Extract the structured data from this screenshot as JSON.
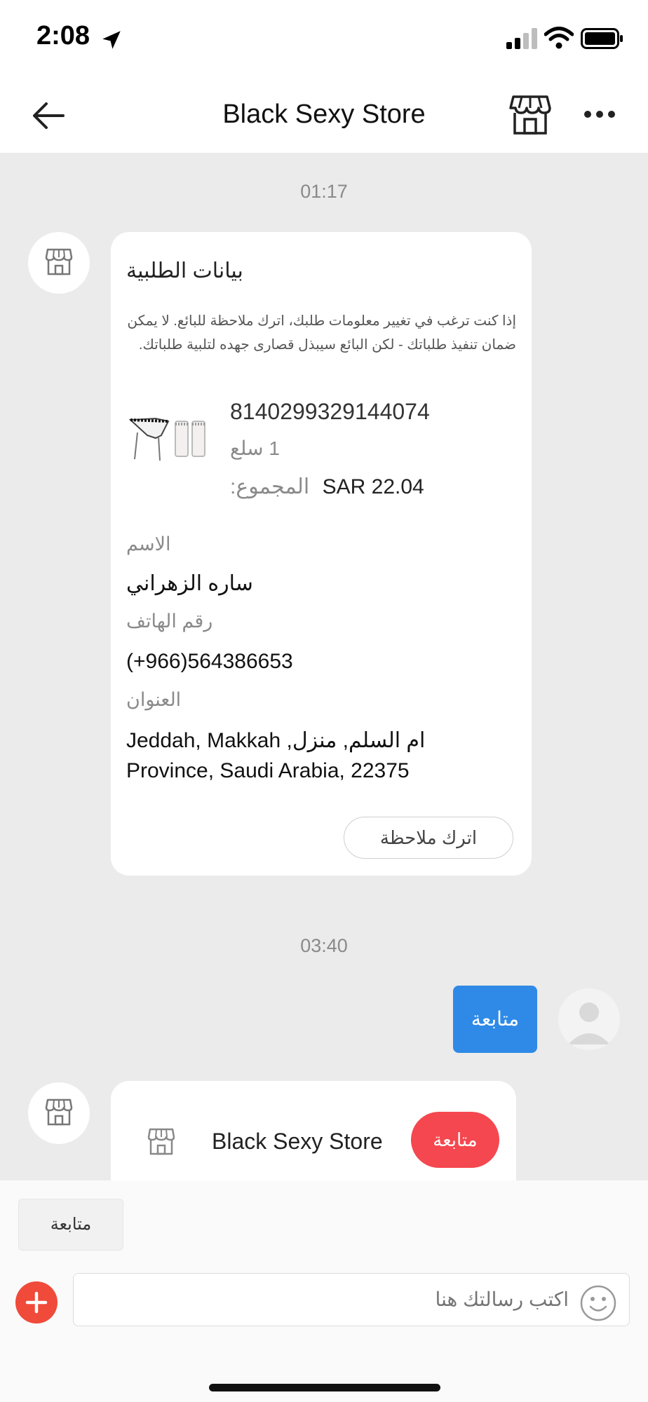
{
  "status_bar": {
    "time": "2:08"
  },
  "header": {
    "title": "Black Sexy Store"
  },
  "chat": {
    "timestamp_1": "01:17",
    "order_card": {
      "title": "بيانات الطلبية",
      "notice": "إذا كنت ترغب في تغيير معلومات طلبك، اترك ملاحظة للبائع. لا يمكن ضمان تنفيذ طلباتك - لكن البائع سيبذل قصارى جهده لتلبية طلباتك.",
      "order_number": "8140299329144074",
      "quantity": "1 سلع",
      "total_label": "المجموع:",
      "total_value": "SAR 22.04",
      "name_label": "الاسم",
      "name_value": "ساره الزهراني",
      "phone_label": "رقم الهاتف",
      "phone_value": "(+966)564386653",
      "address_label": "العنوان",
      "address_line1": "Jeddah, Makkah ,ام السلم, منزل",
      "address_line2": "Province, Saudi Arabia, 22375",
      "leave_note_button": "اترك ملاحظة"
    },
    "timestamp_2": "03:40",
    "user_message": "متابعة",
    "store_card": {
      "store_name": "Black Sexy Store",
      "follow_button": "متابعة"
    }
  },
  "quick_reply": {
    "label": "متابعة"
  },
  "composer": {
    "placeholder": "اكتب رسالتك هنا"
  },
  "colors": {
    "primary_blue": "#2e8ae6",
    "follow_red": "#f5474f",
    "add_button": "#f04a3a",
    "chat_bg": "#ebebeb"
  },
  "icons": [
    "location-arrow-icon",
    "signal-icon",
    "wifi-icon",
    "battery-icon",
    "back-arrow-icon",
    "store-icon",
    "more-icon",
    "plus-icon",
    "emoji-icon",
    "user-avatar-icon"
  ]
}
